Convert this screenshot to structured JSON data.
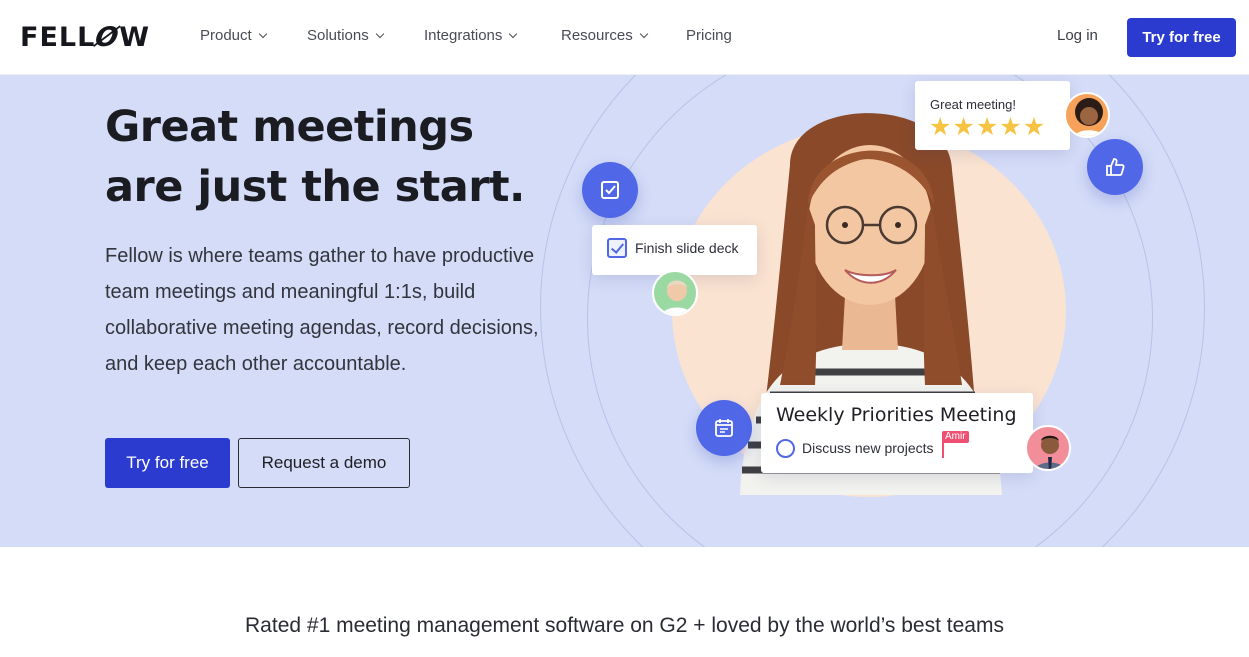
{
  "nav": {
    "logo": "FELLOW",
    "items": [
      {
        "label": "Product",
        "has_dropdown": true
      },
      {
        "label": "Solutions",
        "has_dropdown": true
      },
      {
        "label": "Integrations",
        "has_dropdown": true
      },
      {
        "label": "Resources",
        "has_dropdown": true
      },
      {
        "label": "Pricing",
        "has_dropdown": false
      }
    ],
    "login_label": "Log in",
    "cta_label": "Try for free"
  },
  "hero": {
    "headline_line1": "Great meetings",
    "headline_line2": "are just the start.",
    "description": "Fellow is where teams gather to have productive team meetings and meaningful 1:1s, build collaborative meeting agendas, record decisions, and keep each other accountable.",
    "primary_cta": "Try for free",
    "secondary_cta": "Request a demo"
  },
  "illustration": {
    "task_card_text": "Finish slide deck",
    "rating_card_text": "Great meeting!",
    "rating_stars": 5,
    "meeting_card_title": "Weekly Priorities Meeting",
    "meeting_card_item": "Discuss new projects",
    "cursor_label": "Amir",
    "icons": [
      "checkmark-icon",
      "thumbs-up-icon",
      "calendar-icon"
    ]
  },
  "tagline": "Rated #1 meeting management software on G2 + loved by the world’s best teams",
  "colors": {
    "brand_blue": "#2b3bd0",
    "hero_background": "#d4dcf8",
    "icon_blue": "#5067e8",
    "star_yellow": "#f6c342",
    "cursor_pink": "#ef4f72"
  }
}
